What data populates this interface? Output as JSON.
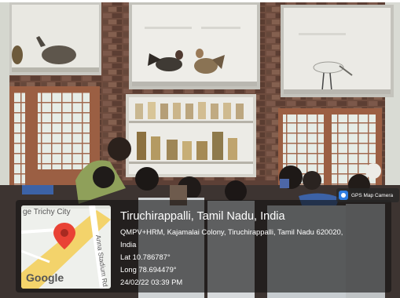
{
  "geotag": {
    "app_label": "GPS Map Camera",
    "location_title": "Tiruchirappalli, Tamil Nadu, India",
    "address_line1": "QMPV+HRM, Kajamalai Colony, Tiruchirappalli, Tamil Nadu 620020,",
    "address_line2": "India",
    "latitude": "Lat 10.786787°",
    "longitude": "Long 78.694479°",
    "datetime": "24/02/22 03:39 PM"
  },
  "map": {
    "city_label": "ge Trichy City",
    "road_label": "Anna Stadium Rd",
    "logo_text": "Google",
    "marker_color": "#e94235",
    "road_color": "#f3d36b"
  },
  "photo": {
    "subject": "museum-gallery-with-bird-displays-and-visitors"
  }
}
